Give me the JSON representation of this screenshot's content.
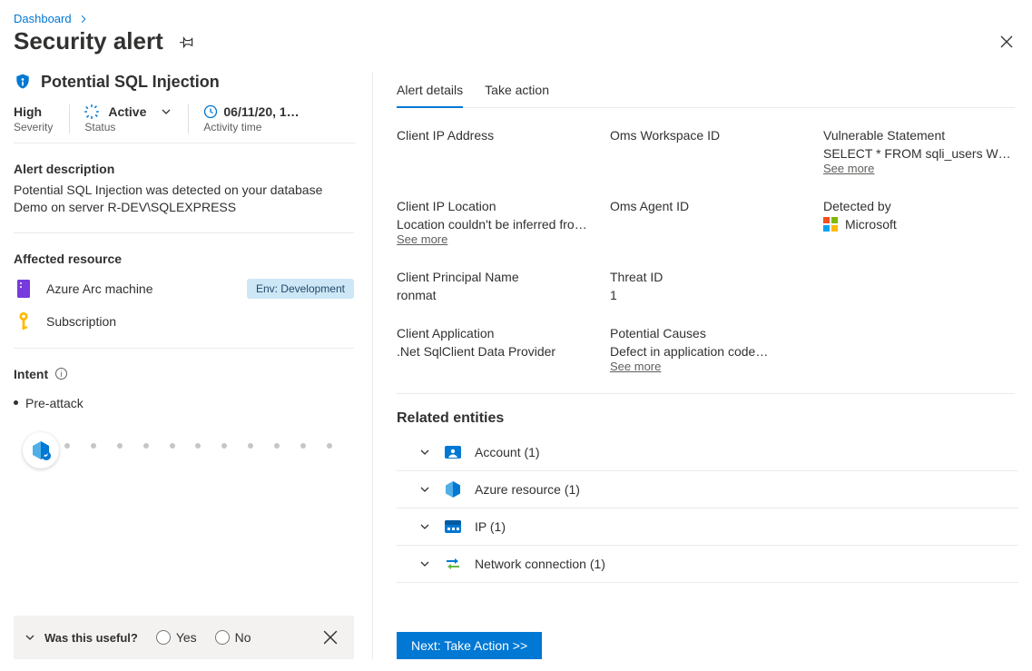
{
  "breadcrumb": {
    "root": "Dashboard"
  },
  "page": {
    "title": "Security alert"
  },
  "alert": {
    "title": "Potential SQL Injection",
    "severity": {
      "value": "High",
      "label": "Severity"
    },
    "status": {
      "value": "Active",
      "label": "Status"
    },
    "activity": {
      "value": "06/11/20, 1…",
      "label": "Activity time"
    },
    "desc_heading": "Alert description",
    "desc_text": "Potential SQL Injection was detected on your database Demo on server R-DEV\\SQLEXPRESS",
    "affected_heading": "Affected resource",
    "resources": [
      {
        "label": "Azure Arc machine",
        "badge": "Env: Development"
      },
      {
        "label": "Subscription",
        "badge": ""
      }
    ],
    "intent": {
      "heading": "Intent",
      "step": "Pre-attack"
    },
    "feedback": {
      "question": "Was this useful?",
      "yes": "Yes",
      "no": "No"
    }
  },
  "tabs": {
    "details": "Alert details",
    "action": "Take action"
  },
  "details": {
    "client_ip_label": "Client IP Address",
    "client_ip_value": "",
    "oms_ws_label": "Oms Workspace ID",
    "oms_ws_value": "",
    "vuln_label": "Vulnerable Statement",
    "vuln_value": "SELECT * FROM sqli_users WHERE…",
    "see_more": "See more",
    "client_loc_label": "Client IP Location",
    "client_loc_value": "Location couldn't be inferred from…",
    "oms_agent_label": "Oms Agent ID",
    "oms_agent_value": "",
    "detected_by_label": "Detected by",
    "detected_by_value": "Microsoft",
    "principal_label": "Client Principal Name",
    "principal_value": "ronmat",
    "threat_label": "Threat ID",
    "threat_value": "1",
    "client_app_label": "Client Application",
    "client_app_value": ".Net SqlClient Data Provider",
    "causes_label": "Potential Causes",
    "causes_value": "Defect in application code…"
  },
  "related": {
    "heading": "Related entities",
    "items": [
      {
        "label": "Account (1)"
      },
      {
        "label": "Azure resource (1)"
      },
      {
        "label": "IP (1)"
      },
      {
        "label": "Network connection (1)"
      }
    ]
  },
  "buttons": {
    "next": "Next: Take Action  >>"
  }
}
